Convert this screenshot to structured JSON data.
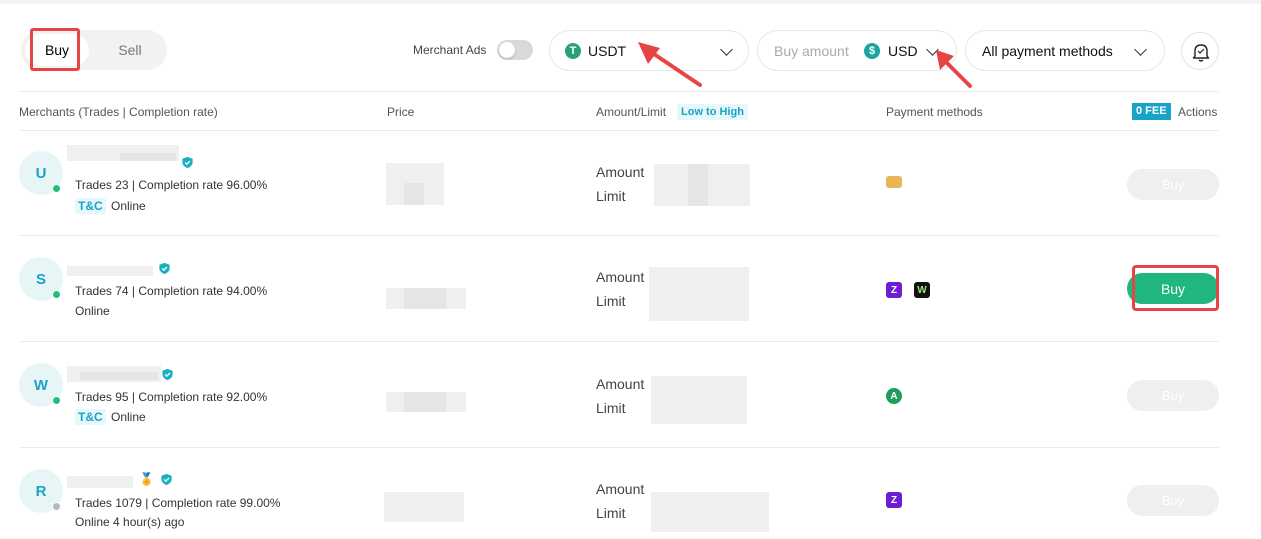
{
  "toolbar": {
    "buy_tab": "Buy",
    "sell_tab": "Sell",
    "merchant_ads_label": "Merchant Ads",
    "merchant_ads_on": false,
    "coin": "USDT",
    "coin_icon": "tether-icon",
    "amount_placeholder": "Buy amount",
    "currency": "USD",
    "currency_icon": "dollar-coin-icon",
    "payment_filter": "All payment methods"
  },
  "table": {
    "headers": {
      "merchants": "Merchants (Trades | Completion rate)",
      "price": "Price",
      "amount_limit": "Amount/Limit",
      "sort": "Low to High",
      "payment": "Payment methods",
      "fee_badge": "0 FEE",
      "actions": "Actions"
    },
    "amount_label": "Amount",
    "limit_label": "Limit",
    "buy_label": "Buy",
    "rows": [
      {
        "initial": "U",
        "stats": "Trades 23 | Completion rate 96.00%",
        "tc": "T&C",
        "status": "Online",
        "online": true,
        "payments": [
          "card-icon"
        ],
        "button_active": false
      },
      {
        "initial": "S",
        "stats": "Trades 74 | Completion rate 94.00%",
        "tc": "",
        "status": "Online",
        "online": true,
        "payments": [
          "zelle-icon",
          "wallet-icon"
        ],
        "button_active": true
      },
      {
        "initial": "W",
        "stats": "Trades 95 | Completion rate 92.00%",
        "tc": "T&C",
        "status": "Online",
        "online": true,
        "payments": [
          "green-bank-icon"
        ],
        "button_active": false
      },
      {
        "initial": "R",
        "stats": "Trades 1079 | Completion rate 99.00%",
        "tc": "",
        "status": "Online 4 hour(s) ago",
        "online": false,
        "payments": [
          "zelle-icon"
        ],
        "button_active": false
      }
    ]
  },
  "colors": {
    "accent": "#1aa3c8",
    "buy_green": "#20b67e",
    "tether_green": "#26a17b",
    "annotation_red": "#e64545"
  }
}
